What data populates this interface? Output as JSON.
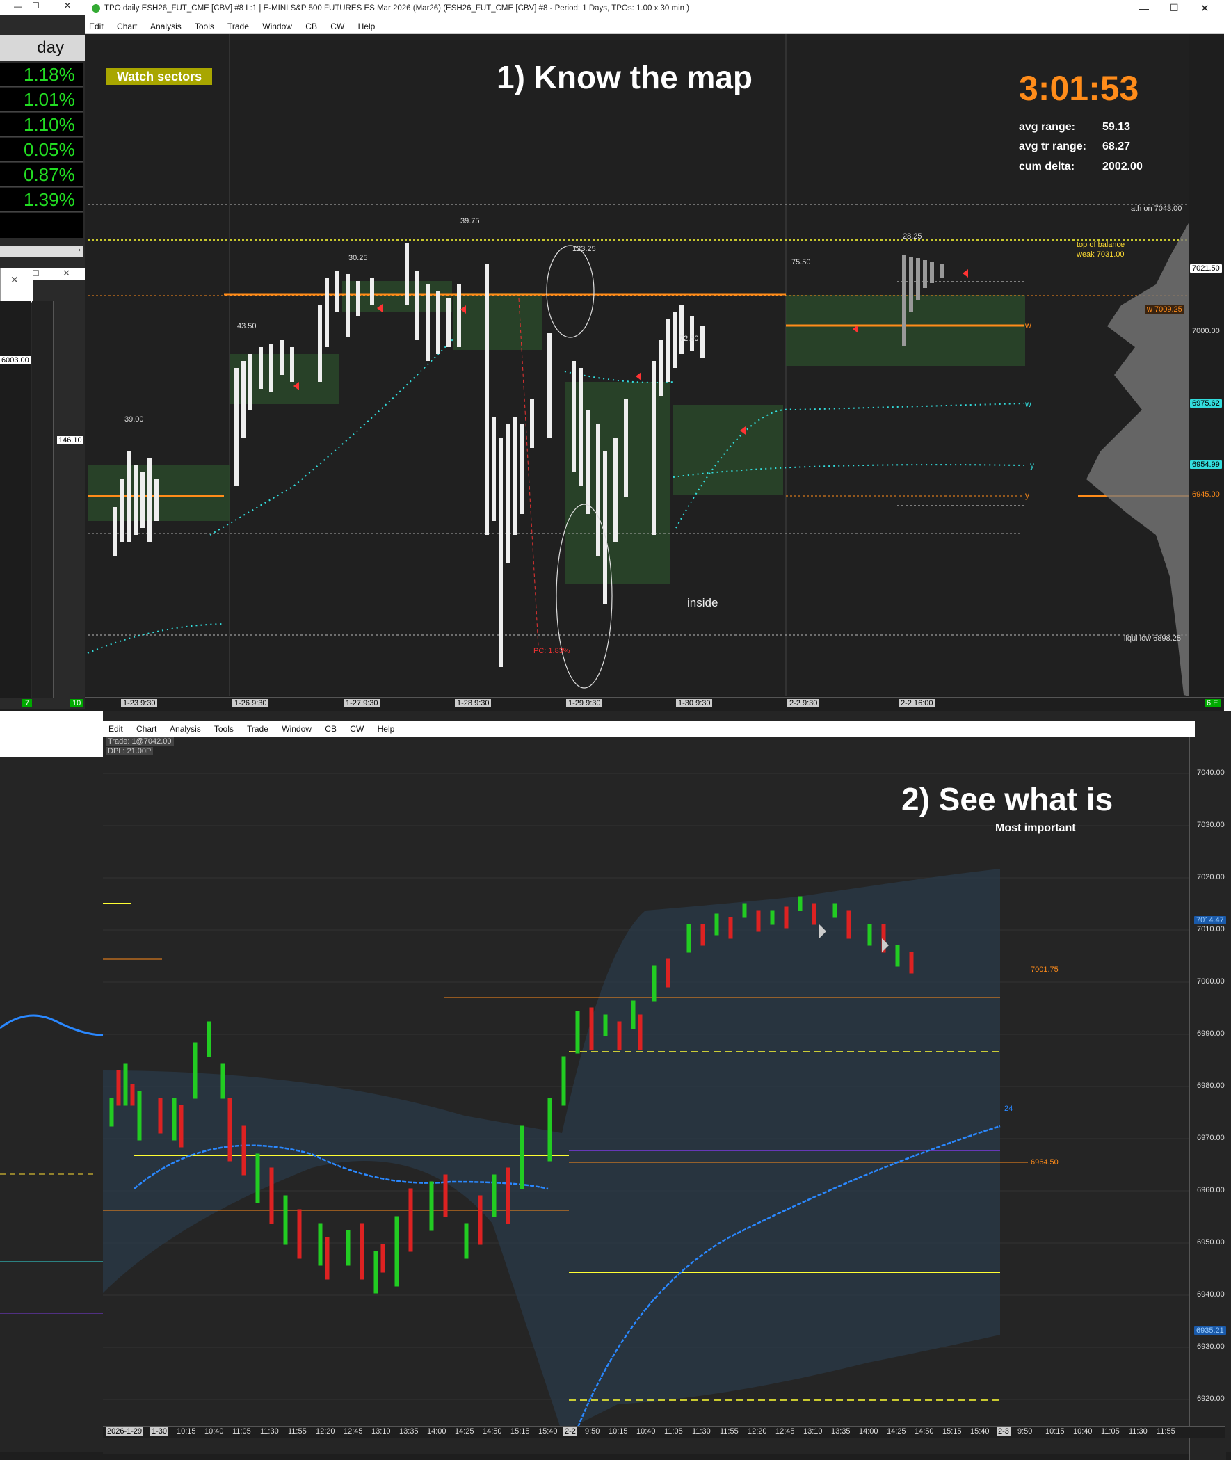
{
  "top_window": {
    "title": "TPO daily ESH26_FUT_CME [CBV] #8 L:1 | E-MINI S&P 500 FUTURES ES Mar 2026 (Mar26) (ESH26_FUT_CME [CBV] #8 - Period: 1 Days, TPOs: 1.00 x 30 min )",
    "menu": [
      "Edit",
      "Chart",
      "Analysis",
      "Tools",
      "Trade",
      "Window",
      "CB",
      "CW",
      "Help"
    ],
    "heading": "1)  Know the map",
    "badge": "Watch sectors",
    "timer": "3:01:53",
    "stats": [
      {
        "label": "avg range:",
        "value": "59.13"
      },
      {
        "label": "avg tr range:",
        "value": "68.27"
      },
      {
        "label": "cum delta:",
        "value": "2002.00"
      }
    ],
    "annotations": {
      "ath": "ath on  7043.00",
      "top_balance_1": "top of balance",
      "top_balance_2": "weak  7031.00",
      "liqui_low": "liqui low  6898.25",
      "inside": "inside",
      "pc": "PC: 1.83%",
      "w1": "w",
      "w2": "w",
      "y1": "y",
      "y2": "y"
    },
    "range_labels": [
      "39.00",
      "43.50",
      "30.25",
      "39.75",
      "123.25",
      "72.50",
      "75.50",
      "28.25"
    ],
    "price_labels": [
      {
        "text": "7021.50",
        "color": "#ffffff"
      },
      {
        "text": "w  7009.25",
        "color": "#ff8c1a"
      },
      {
        "text": "7000.00",
        "color": "#dddddd"
      },
      {
        "text": "6975.62",
        "color": "#33dddd"
      },
      {
        "text": "6954.99",
        "color": "#33dddd"
      },
      {
        "text": "6945.00",
        "color": "#ff8c1a"
      }
    ],
    "date_labels": [
      "1-23  9:30",
      "1-26  9:30",
      "1-27  9:30",
      "1-28  9:30",
      "1-29  9:30",
      "1-30  9:30",
      "2-2  9:30",
      "2-2  16:00"
    ]
  },
  "left_panel": {
    "header": "day",
    "percentages": [
      "1.18%",
      "1.01%",
      "1.10%",
      "0.05%",
      "0.87%",
      "1.39%"
    ],
    "value_6003": "6003.00",
    "value_146": "146.10",
    "badge_7": "7",
    "badge_10": "10",
    "badge_6e": "6 E"
  },
  "bottom_window": {
    "menu": [
      "Edit",
      "Chart",
      "Analysis",
      "Tools",
      "Trade",
      "Window",
      "CB",
      "CW",
      "Help"
    ],
    "trade_info_1": "Trade: 1@7042.00",
    "trade_info_2": "DPL: 21.00P",
    "heading": "2)  See what is",
    "subheading": "Most important",
    "y_ticks": [
      "7040.00",
      "7030.00",
      "7020.00",
      "7010.00",
      "7000.00",
      "6990.00",
      "6980.00",
      "6970.00",
      "6960.00",
      "6950.00",
      "6940.00",
      "6930.00",
      "6920.00"
    ],
    "price_box_1": "7014.47",
    "price_box_2": "6935.21",
    "line_label_1": "7001.75",
    "line_label_2": "6964.50",
    "line_label_3": "24",
    "x_ticks": [
      "2026-1-29",
      "1-30",
      "10:15",
      "10:40",
      "11:05",
      "11:30",
      "11:55",
      "12:20",
      "12:45",
      "13:10",
      "13:35",
      "14:00",
      "14:25",
      "14:50",
      "15:15",
      "15:40",
      "2-2",
      "9:50",
      "10:15",
      "10:40",
      "11:05",
      "11:30",
      "11:55",
      "12:20",
      "12:45",
      "13:10",
      "13:35",
      "14:00",
      "14:25",
      "14:50",
      "15:15",
      "15:40",
      "2-3",
      "9:50",
      "10:15",
      "10:40",
      "11:05",
      "11:30",
      "11:55"
    ]
  },
  "colors": {
    "accent_orange": "#ff8c1a",
    "badge_olive": "#a8a600",
    "up_green": "#22cc22",
    "down_red": "#cc2222",
    "cyan": "#33dddd",
    "yellow": "#ffff33"
  }
}
